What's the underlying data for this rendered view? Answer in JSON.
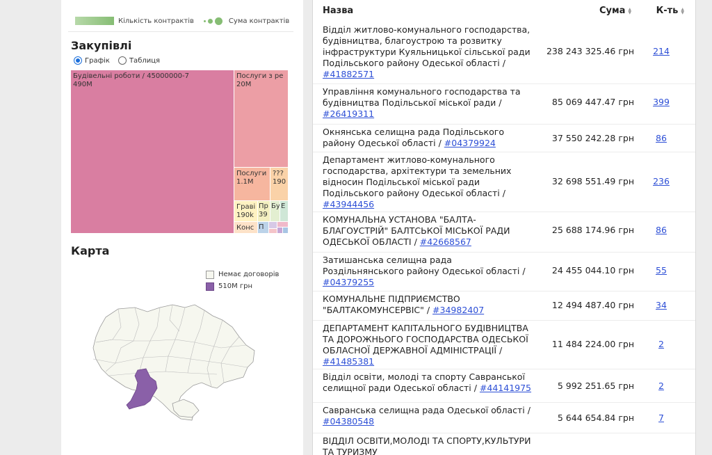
{
  "legend_top": {
    "count_label": "Кількість контрактів",
    "sum_label": "Сума контрактів"
  },
  "procurement": {
    "title": "Закупівлі",
    "view_options": [
      {
        "label": "Графік",
        "selected": true
      },
      {
        "label": "Таблиця",
        "selected": false
      }
    ]
  },
  "treemap": {
    "tiles": [
      {
        "label": "Будівельні роботи / 45000000-7",
        "value": "490M",
        "color": "#d97ea1"
      },
      {
        "label": "Послуги з ре",
        "value": "20M",
        "color": "#ec9ea5"
      },
      {
        "label": "Послуги",
        "value": "1.1M",
        "color": "#f6b69f"
      },
      {
        "label": "???",
        "value": "190",
        "color": "#fad2a8"
      },
      {
        "label": "Граві",
        "value": "190k",
        "color": "#fff2c2"
      },
      {
        "label": "Пр",
        "value": "39",
        "color": "#f3efc0"
      },
      {
        "label": "Бу",
        "value": "",
        "color": "#e3efd1"
      },
      {
        "label": "Е",
        "value": "",
        "color": "#cfe7d7"
      },
      {
        "label": "Конс",
        "value": "",
        "color": "#fde2c8"
      },
      {
        "label": "П",
        "value": "",
        "color": "#bcd3e9"
      },
      {
        "label": "",
        "value": "",
        "color": "#d7c9e6"
      },
      {
        "label": "",
        "value": "",
        "color": "#f0b9c9"
      },
      {
        "label": "",
        "value": "",
        "color": "#f4c4c9"
      },
      {
        "label": "",
        "value": "",
        "color": "#c6a7d6"
      },
      {
        "label": "",
        "value": "",
        "color": "#a8c5e4"
      }
    ]
  },
  "map": {
    "title": "Карта",
    "legend": [
      {
        "label": "Немає договорів",
        "color": "#f6f7ef"
      },
      {
        "label": "510M грн",
        "color": "#8a60a8"
      }
    ]
  },
  "table": {
    "headers": {
      "name": "Назва",
      "sum": "Сума",
      "count": "К-ть"
    },
    "rows": [
      {
        "name": "Відділ житлово-комунального господарства, будівництва, благоустрою та розвитку інфраструктури Куяльницької сільської ради Подільського району Одеської області / ",
        "code": "#41882571",
        "sum": "238 243 325.46 грн",
        "count": "214"
      },
      {
        "name": "Управління комунального господарства та будівництва Подільської міської ради / ",
        "code": "#26419311",
        "sum": "85 069 447.47 грн",
        "count": "399"
      },
      {
        "name": "Окнянська селищна рада Подільського району Одеської області / ",
        "code": "#04379924",
        "sum": "37 550 242.28 грн",
        "count": "86"
      },
      {
        "name": "Департамент житлово-комунального господарства, архітектури та земельних відносин Подільської міської ради Подільського району Одеської області / ",
        "code": "#43944456",
        "sum": "32 698 551.49 грн",
        "count": "236"
      },
      {
        "name": "КОМУНАЛЬНА УСТАНОВА \"БАЛТА-БЛАГОУСТРІЙ\" БАЛТСЬКОЇ МІСЬКОЇ РАДИ ОДЕСЬКОЇ ОБЛАСТІ / ",
        "code": "#42668567",
        "sum": "25 688 174.96 грн",
        "count": "86"
      },
      {
        "name": "Затишанська селищна рада Роздільнянського району Одеської області / ",
        "code": "#04379255",
        "sum": "24 455 044.10 грн",
        "count": "55"
      },
      {
        "name": "КОМУНАЛЬНЕ ПІДПРИЄМСТВО \"БАЛТАКОМУНСЕРВІС\" / ",
        "code": "#34982407",
        "sum": "12 494 487.40 грн",
        "count": "34"
      },
      {
        "name": "ДЕПАРТАМЕНТ КАПІТАЛЬНОГО БУДІВНИЦТВА ТА ДОРОЖНЬОГО ГОСПОДАРСТВА ОДЕСЬКОЇ ОБЛАСНОЇ ДЕРЖАВНОЇ АДМІНІСТРАЦІЇ / ",
        "code": "#41485381",
        "sum": "11 484 224.00 грн",
        "count": "2"
      },
      {
        "name": "Відділ освіти, молоді та спорту Савранської селищної ради Одеської області / ",
        "code": "#44141975",
        "sum": "5 992 251.65 грн",
        "count": "2"
      },
      {
        "name": "Савранська селищна рада Одеської області / ",
        "code": "#04380548",
        "sum": "5 644 654.84 грн",
        "count": "7"
      },
      {
        "name": "ВІДДІЛ ОСВІТИ,МОЛОДІ ТА СПОРТУ,КУЛЬТУРИ ТА ТУРИЗМУ",
        "code": "",
        "sum": "",
        "count": ""
      }
    ]
  }
}
